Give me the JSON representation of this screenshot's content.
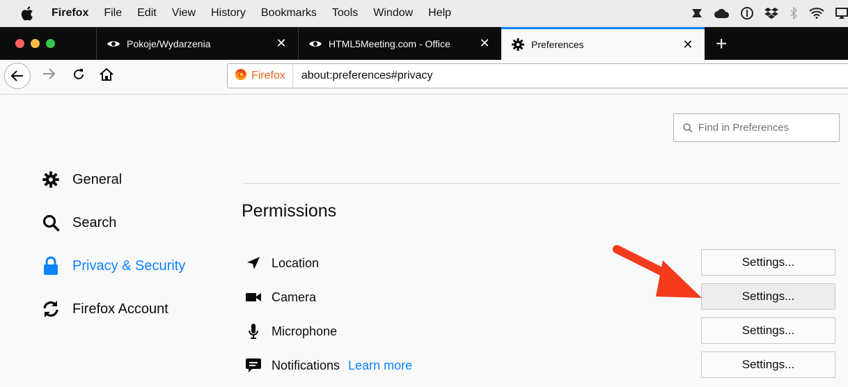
{
  "menubar": {
    "items": [
      "Firefox",
      "File",
      "Edit",
      "View",
      "History",
      "Bookmarks",
      "Tools",
      "Window",
      "Help"
    ]
  },
  "tabs": [
    {
      "title": "Pokoje/Wydarzenia",
      "icon": "eye-icon",
      "close": "✕"
    },
    {
      "title": "HTML5Meeting.com - Office",
      "icon": "eye-icon",
      "close": "✕"
    },
    {
      "title": "Preferences",
      "icon": "gear-icon",
      "close": "✕",
      "active": true
    }
  ],
  "newtab_label": "+",
  "urlbar": {
    "identity_label": "Firefox",
    "url": "about:preferences#privacy"
  },
  "find": {
    "placeholder": "Find in Preferences"
  },
  "categories": [
    {
      "label": "General",
      "icon": "gear-icon"
    },
    {
      "label": "Search",
      "icon": "search-icon"
    },
    {
      "label": "Privacy & Security",
      "icon": "lock-icon",
      "selected": true
    },
    {
      "label": "Firefox Account",
      "icon": "sync-icon"
    }
  ],
  "permissions": {
    "title": "Permissions",
    "rows": [
      {
        "label": "Location",
        "icon": "location-arrow-icon",
        "button": "Settings..."
      },
      {
        "label": "Camera",
        "icon": "camera-icon",
        "button": "Settings..."
      },
      {
        "label": "Microphone",
        "icon": "microphone-icon",
        "button": "Settings..."
      },
      {
        "label": "Notifications",
        "icon": "notification-icon",
        "button": "Settings...",
        "link": "Learn more"
      }
    ]
  },
  "colors": {
    "accent": "#0a84ff",
    "annotation_arrow": "#f43b1c",
    "tabbar": "#0c0c0d"
  }
}
